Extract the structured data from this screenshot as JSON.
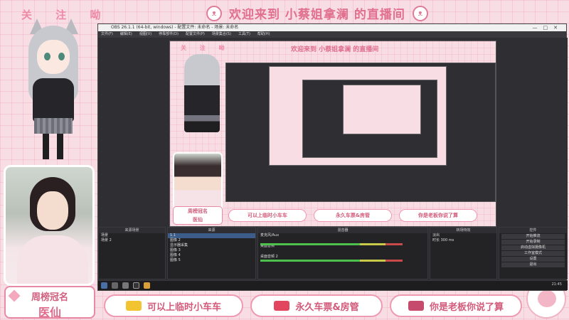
{
  "overlay": {
    "follow": "关 注 呦",
    "title": "欢迎来到 小蔡姐拿澜 的直播间",
    "badge_line1": "周榜冠名",
    "badge_line2": "医仙",
    "buttons": [
      {
        "label": "可以上临时小车车",
        "color": "#f2c431"
      },
      {
        "label": "永久车票&房管",
        "color": "#e2465f"
      },
      {
        "label": "你是老板你说了算",
        "color": "#c64a6c"
      }
    ]
  },
  "obs": {
    "title": "OBS 26.1.1 (64-bit, windows) - 配置文件: 未命名 - 场景: 未命名",
    "menu": [
      "文件(F)",
      "编辑(E)",
      "视图(V)",
      "停靠部件(D)",
      "配置文件(P)",
      "场景集合(S)",
      "工具(T)",
      "帮助(H)"
    ],
    "docks": {
      "scenes_header": "来源场景",
      "scenes": [
        "场景",
        "场景 2"
      ],
      "sources_header": "来源",
      "sources": [
        "1.1",
        "图像 2",
        "显示器采集",
        "图像 3",
        "图像 4",
        "图像 5"
      ],
      "mixer_header": "混音器",
      "mixer": [
        {
          "name": "麦克风/Aux",
          "db": "0.0 dB"
        },
        {
          "name": "桌面音频",
          "db": "0.0 dB"
        },
        {
          "name": "桌面音频 2",
          "db": "0.0 dB"
        }
      ],
      "transitions_header": "转场特效",
      "transition_name": "淡出",
      "transition_duration_label": "时长",
      "transition_duration": "300 ms",
      "controls_header": "控件",
      "controls": [
        "开始推流",
        "开始录制",
        "启动虚拟摄像机",
        "工作室模式",
        "设置",
        "退出"
      ]
    },
    "clock": "21:45"
  }
}
